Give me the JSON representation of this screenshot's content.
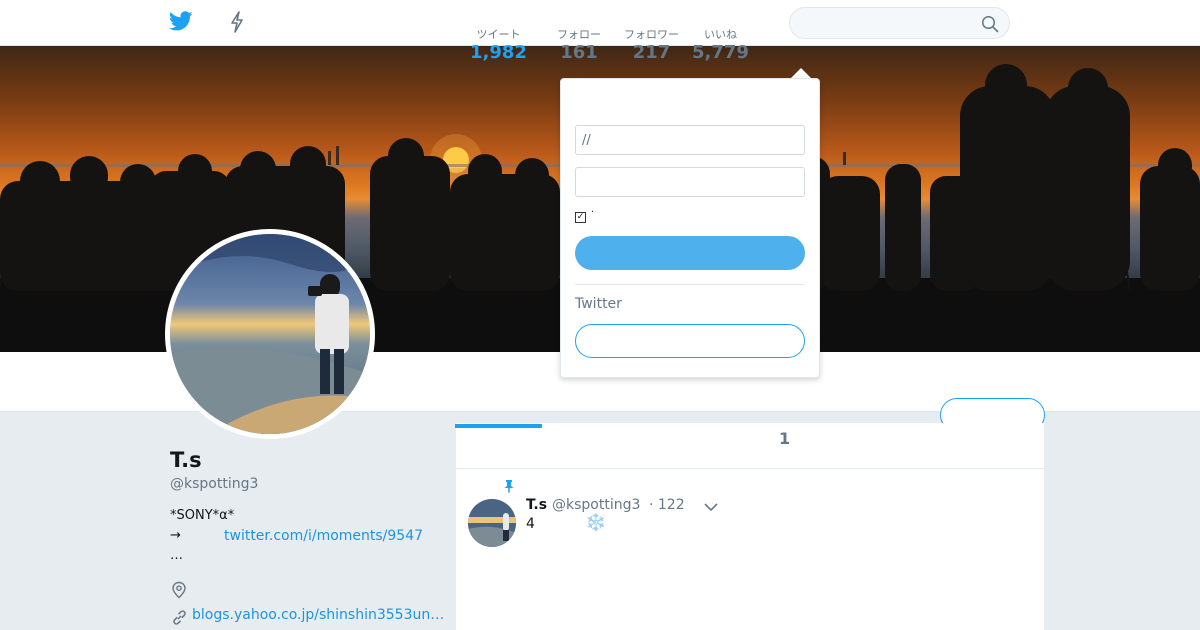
{
  "nav": {
    "home_icon": "twitter-bird-icon",
    "moments_icon": "lightning-bolt-icon",
    "search_placeholder": "",
    "search_icon": "search-icon"
  },
  "profile": {
    "name": "T.s",
    "handle": "@kspotting3",
    "bio_line1": "*SONY*α*",
    "bio_arrow": "→",
    "bio_link": "twitter.com/i/moments/9547",
    "bio_line3": "…",
    "website": "blogs.yahoo.co.jp/shinshin3553un…"
  },
  "stats": [
    {
      "label": "ツイート",
      "value": "1,982"
    },
    {
      "label": "フォロー",
      "value": "161"
    },
    {
      "label": "フォロワー",
      "value": "217"
    },
    {
      "label": "いいね",
      "value": "5,779"
    }
  ],
  "timeline": {
    "tab_count": "1",
    "tweet": {
      "name": "T.s",
      "handle": "@kspotting3",
      "time": "· 122",
      "text": "4",
      "emoji": "❄️"
    }
  },
  "login_dropdown": {
    "username_value": "//",
    "password_value": "",
    "remember_label": "·",
    "signup_label": "Twitter"
  },
  "colors": {
    "brand_blue": "#1da1f2",
    "link_blue": "#1b95e0",
    "background": "#e6ecf0"
  }
}
